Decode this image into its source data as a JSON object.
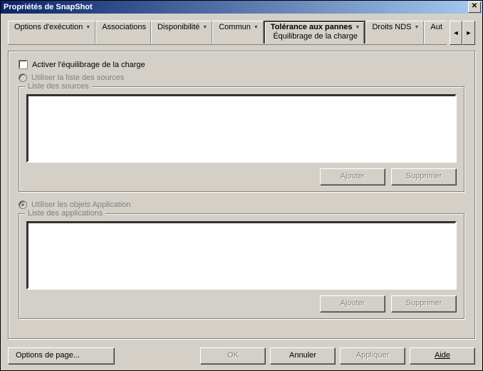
{
  "window": {
    "title": "Propriétés de SnapShot"
  },
  "tabs": {
    "items": [
      {
        "label": "Options d'exécution"
      },
      {
        "label": "Associations"
      },
      {
        "label": "Disponibilité"
      },
      {
        "label": "Commun"
      },
      {
        "label": "Tolérance aux pannes",
        "sub": "Équilibrage de la charge"
      },
      {
        "label": "Droits NDS"
      },
      {
        "label": "Aut"
      }
    ],
    "left_arrow": "◄",
    "right_arrow": "►"
  },
  "content": {
    "enable_lb_label": "Activer l'équilibrage de la charge",
    "use_sources_label": "Utiliser la liste des sources",
    "sources_group": "Liste des sources",
    "use_apps_label": "Utiliser les objets Application",
    "apps_group": "Liste des applications",
    "add_btn": "Ajouter",
    "remove_btn": "Supprimer"
  },
  "footer": {
    "page_options": "Options de page...",
    "ok": "OK",
    "cancel": "Annuler",
    "apply": "Appliquer",
    "help": "Aide"
  }
}
